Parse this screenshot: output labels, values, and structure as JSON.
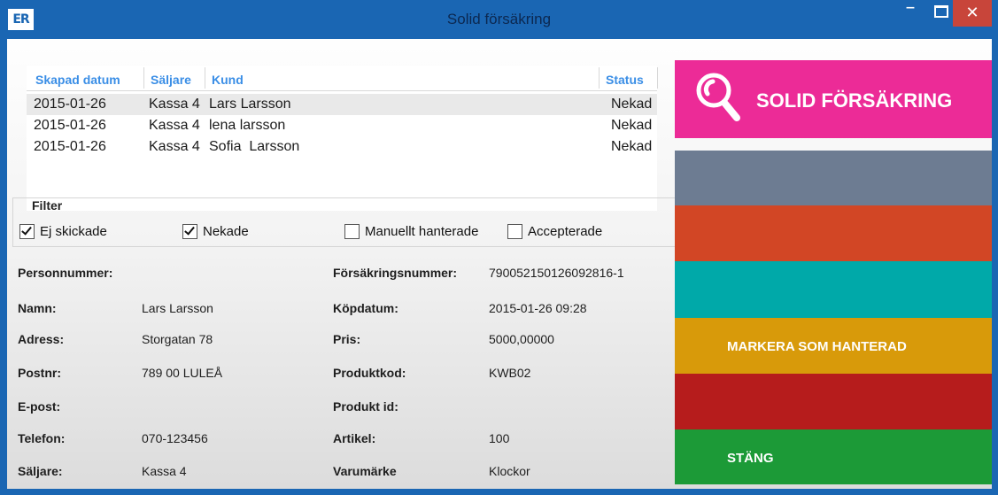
{
  "window": {
    "title": "Solid försäkring",
    "icon_text": "ER"
  },
  "grid": {
    "headers": {
      "created": "Skapad datum",
      "seller": "Säljare",
      "customer": "Kund",
      "status": "Status"
    },
    "rows": [
      {
        "created": "2015-01-26",
        "seller": "Kassa 4",
        "customer": "Lars Larsson",
        "status": "Nekad"
      },
      {
        "created": "2015-01-26",
        "seller": "Kassa 4",
        "customer": "lena larsson",
        "status": "Nekad"
      },
      {
        "created": "2015-01-26",
        "seller": "Kassa 4",
        "customer": "Sofia  Larsson",
        "status": "Nekad"
      }
    ]
  },
  "filter": {
    "title": "Filter",
    "options": [
      {
        "label": "Ej skickade",
        "checked": true
      },
      {
        "label": "Nekade",
        "checked": true
      },
      {
        "label": "Manuellt hanterade",
        "checked": false
      },
      {
        "label": "Accepterade",
        "checked": false
      }
    ]
  },
  "details": {
    "personnummer": {
      "label": "Personnummer:",
      "value": ""
    },
    "namn": {
      "label": "Namn:",
      "value": "Lars Larsson"
    },
    "adress": {
      "label": "Adress:",
      "value": "Storgatan 78"
    },
    "postnr": {
      "label": "Postnr:",
      "value": "789 00 LULEÅ"
    },
    "epost": {
      "label": "E-post:",
      "value": ""
    },
    "telefon": {
      "label": "Telefon:",
      "value": "070-123456"
    },
    "saljare": {
      "label": "Säljare:",
      "value": "Kassa 4"
    },
    "forsakringsnummer": {
      "label": "Försäkringsnummer:",
      "value": "790052150126092816-1"
    },
    "kopdatum": {
      "label": "Köpdatum:",
      "value": "2015-01-26 09:28"
    },
    "pris": {
      "label": "Pris:",
      "value": "5000,00000"
    },
    "produktkod": {
      "label": "Produktkod:",
      "value": "KWB02"
    },
    "produktid": {
      "label": "Produkt id:",
      "value": ""
    },
    "artikel": {
      "label": "Artikel:",
      "value": "100"
    },
    "varumarke": {
      "label": "Varumärke",
      "value": "Klockor"
    }
  },
  "side": {
    "logo_text": "SOLID FÖRSÄKRING",
    "mark_handled": "MARKERA SOM HANTERAD",
    "close": "STÄNG",
    "colors": {
      "logo": "#ec2b97",
      "slate": "#6d7c92",
      "orange": "#d24625",
      "teal": "#00a9a9",
      "gold": "#d89a0a",
      "red": "#b61c1c",
      "green": "#1c9a37"
    }
  }
}
